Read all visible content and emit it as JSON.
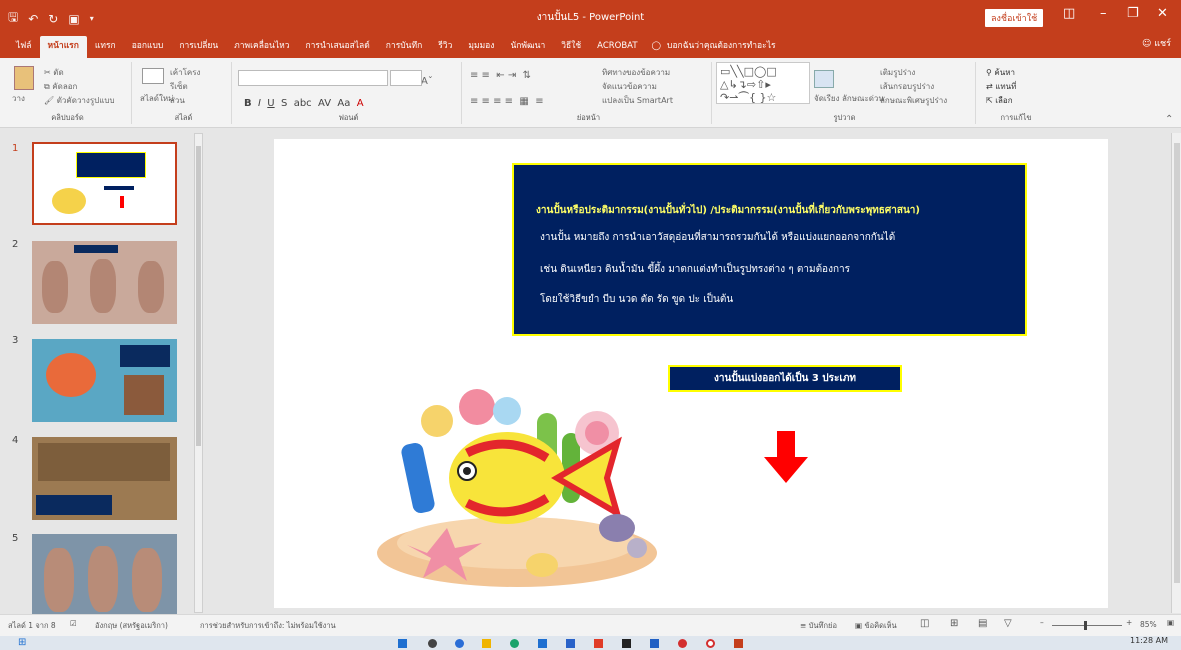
{
  "window": {
    "title": "งานปั้นL5 - PowerPoint",
    "signin_label": "ลงชื่อเข้าใช้",
    "share_label": "แชร์"
  },
  "tabs": [
    {
      "label": "ไฟล์",
      "active": false
    },
    {
      "label": "หน้าแรก",
      "active": true
    },
    {
      "label": "แทรก",
      "active": false
    },
    {
      "label": "ออกแบบ",
      "active": false
    },
    {
      "label": "การเปลี่ยน",
      "active": false
    },
    {
      "label": "ภาพเคลื่อนไหว",
      "active": false
    },
    {
      "label": "การนำเสนอสไลด์",
      "active": false
    },
    {
      "label": "การบันทึก",
      "active": false
    },
    {
      "label": "รีวิว",
      "active": false
    },
    {
      "label": "มุมมอง",
      "active": false
    },
    {
      "label": "นักพัฒนา",
      "active": false
    },
    {
      "label": "วิธีใช้",
      "active": false
    },
    {
      "label": "ACROBAT",
      "active": false
    }
  ],
  "tellme": "บอกฉันว่าคุณต้องการทำอะไร",
  "ribbon": {
    "clipboard": {
      "label": "คลิปบอร์ด",
      "paste": "วาง",
      "cut": "ตัด",
      "copy": "คัดลอก",
      "format_painter": "ตัวคัดวางรูปแบบ"
    },
    "slides": {
      "label": "สไลด์",
      "new_slide": "สไลด์ใหม่",
      "layout": "เค้าโครง",
      "reset": "รีเซ็ต",
      "section": "ส่วน"
    },
    "font": {
      "label": "ฟอนต์",
      "font_name": "",
      "font_size": ""
    },
    "paragraph": {
      "label": "ย่อหน้า",
      "text_direction": "ทิศทางของข้อความ",
      "align_text": "จัดแนวข้อความ",
      "smartart": "แปลงเป็น SmartArt"
    },
    "drawing": {
      "label": "รูปวาด",
      "arrange": "จัดเรียง",
      "quick_styles": "ลักษณะด่วน",
      "shape_fill": "เติมรูปร่าง",
      "shape_outline": "เส้นกรอบรูปร่าง",
      "shape_effects": "ลักษณะพิเศษรูปร่าง"
    },
    "editing": {
      "label": "การแก้ไข",
      "find": "ค้นหา",
      "replace": "แทนที่",
      "select": "เลือก"
    }
  },
  "thumbnails": [
    {
      "num": "1",
      "selected": true
    },
    {
      "num": "2",
      "selected": false
    },
    {
      "num": "3",
      "selected": false
    },
    {
      "num": "4",
      "selected": false
    },
    {
      "num": "5",
      "selected": false
    }
  ],
  "slide": {
    "heading": "งานปั้นหรือประติมากรรม(งานปั้นทั่วไป) /ประติมากรรม(งานปั้นที่เกี่ยวกับพระพุทธศาสนา)",
    "line1": "งานปั้น  หมายถึง การนำเอาวัสดุอ่อนที่สามารถรวมกันได้  หรือแบ่งแยกออกจากกันได้",
    "line2": "เช่น  ดินเหนียว  ดินน้ำมัน  ขี้ผึ้ง มาตกแต่งทำเป็นรูปทรงต่าง ๆ ตามต้องการ",
    "line3": "โดยใช้วิธีขยำ  บีบ  นวด  ตัด  รัด  ขูด  ปะ  เป็นต้น",
    "subtitle": "งานปั้นแบ่งออกได้เป็น  3  ประเภท",
    "colors": {
      "box_bg": "#002060",
      "box_border": "#ffff00",
      "arrow": "#ff0000"
    }
  },
  "statusbar": {
    "slide_counter": "สไลด์ 1 จาก 8",
    "language": "อังกฤษ (สหรัฐอเมริกา)",
    "accessibility": "การช่วยสำหรับการเข้าถึง: ไม่พร้อมใช้งาน",
    "notes": "บันทึกย่อ",
    "comments": "ข้อคิดเห็น",
    "zoom": "85%"
  },
  "clock": "11:28 AM"
}
